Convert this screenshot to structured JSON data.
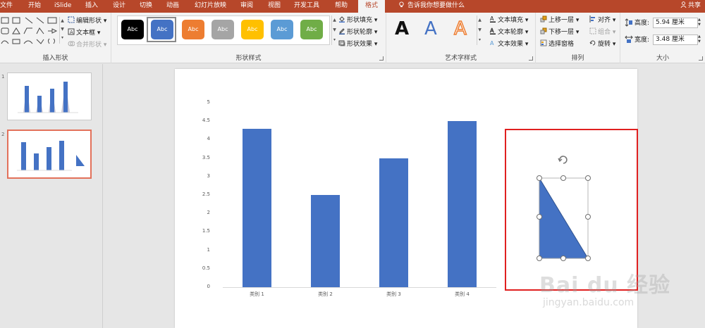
{
  "tabs": [
    "文件",
    "开始",
    "iSlide",
    "插入",
    "设计",
    "切换",
    "动画",
    "幻灯片放映",
    "审阅",
    "视图",
    "开发工具",
    "帮助",
    "格式"
  ],
  "active_tab": "格式",
  "tell_me": "告诉我你想要做什么",
  "share": "共享",
  "ribbon": {
    "insert_shapes": {
      "label": "插入形状",
      "edit_shape": "编辑形状",
      "text_box": "文本框",
      "merge_shapes": "合并形状"
    },
    "shape_styles": {
      "label": "形状样式",
      "style_text": "Abc",
      "fill": "形状填充",
      "outline": "形状轮廓",
      "effects": "形状效果"
    },
    "wordart": {
      "label": "艺术字样式",
      "sample": "A",
      "text_fill": "文本填充",
      "text_outline": "文本轮廓",
      "text_effects": "文本效果"
    },
    "arrange": {
      "label": "排列",
      "bring_forward": "上移一层",
      "send_backward": "下移一层",
      "selection_pane": "选择窗格",
      "align": "对齐",
      "group": "组合",
      "rotate": "旋转"
    },
    "size": {
      "label": "大小",
      "height_label": "高度:",
      "height_value": "5.94 厘米",
      "width_label": "宽度:",
      "width_value": "3.48 厘米"
    }
  },
  "slides": [
    {
      "number": "1"
    },
    {
      "number": "2"
    }
  ],
  "chart_data": {
    "type": "bar",
    "categories": [
      "类别 1",
      "类别 2",
      "类别 3",
      "类别 4"
    ],
    "values": [
      4.3,
      2.5,
      3.5,
      4.5
    ],
    "yticks": [
      "0",
      "0.5",
      "1",
      "1.5",
      "2",
      "2.5",
      "3",
      "3.5",
      "4",
      "4.5",
      "5"
    ],
    "ylim": [
      0,
      5
    ],
    "color": "#4472c4"
  },
  "watermark": {
    "brand": "Bai du 经验",
    "url": "jingyan.baidu.com"
  }
}
